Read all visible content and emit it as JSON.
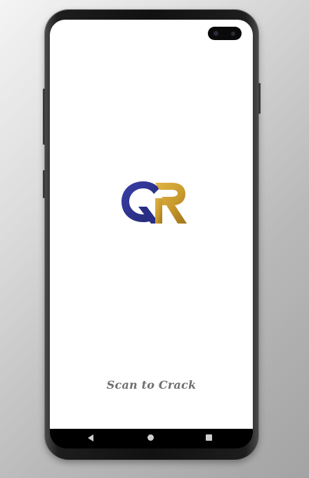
{
  "app": {
    "logo_text": "QR",
    "tagline": "Scan to Crack"
  },
  "navigation_bar": {
    "items": [
      "back-icon",
      "home-icon",
      "recents-icon"
    ]
  },
  "colors": {
    "logo_primary": "#2a2f8f",
    "logo_accent": "#c99a2e",
    "tagline": "#6f6f6f",
    "screen_background": "#ffffff"
  }
}
